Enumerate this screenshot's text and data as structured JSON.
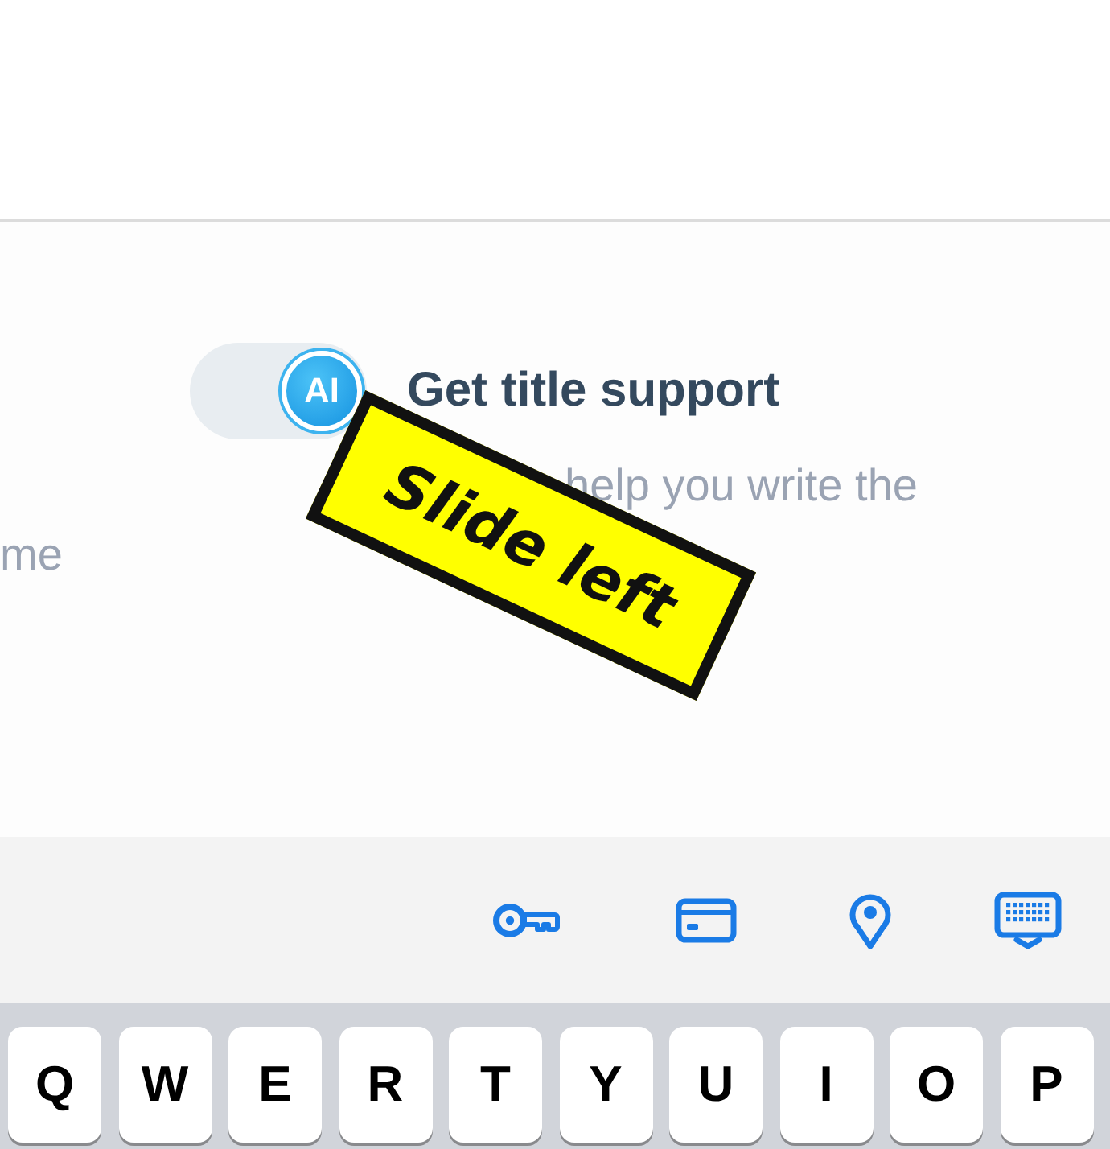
{
  "content": {
    "toggle": {
      "on": true,
      "badge": "AI"
    },
    "title": "Get title support",
    "description_lines": [
      "help you write the",
      "me"
    ]
  },
  "annotation": {
    "text": "Slide left"
  },
  "keyboard": {
    "keys": [
      "Q",
      "W",
      "E",
      "R",
      "T",
      "Y",
      "U",
      "I",
      "O",
      "P"
    ]
  }
}
